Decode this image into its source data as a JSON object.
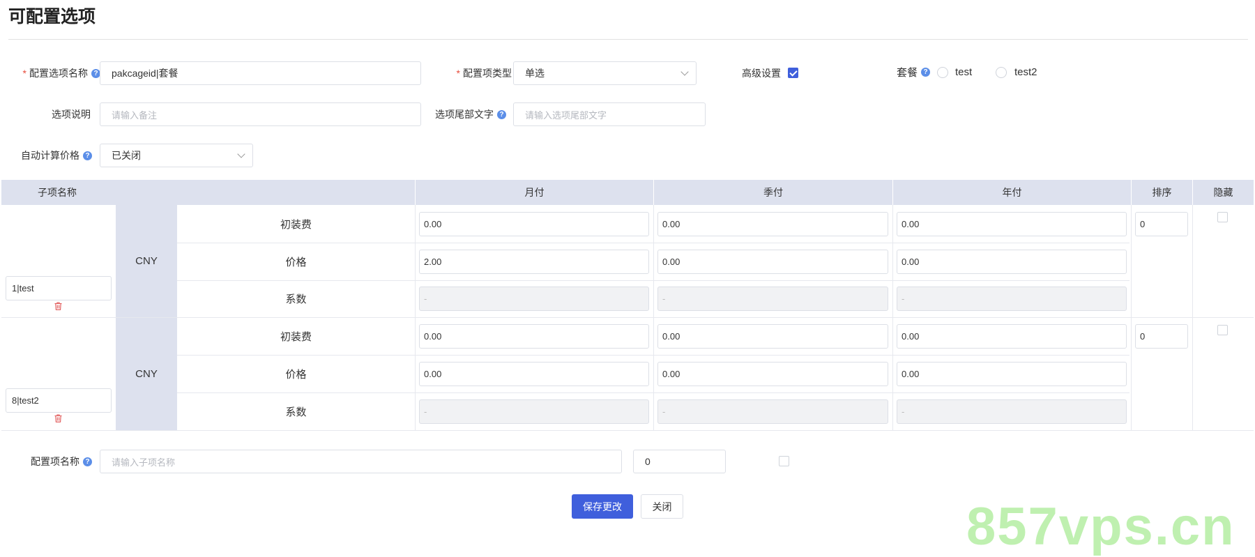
{
  "page": {
    "title": "可配置选项",
    "watermark": "857vps.cn"
  },
  "form": {
    "option_name": {
      "required_mark": "*",
      "label": "配置选项名称",
      "value": "pakcageid|套餐"
    },
    "option_type": {
      "required_mark": "*",
      "label": "配置项类型",
      "value": "单选"
    },
    "advanced": {
      "label": "高级设置",
      "checked": true
    },
    "package": {
      "label": "套餐",
      "options": [
        "test",
        "test2"
      ]
    },
    "description": {
      "label": "选项说明",
      "placeholder": "请输入备注"
    },
    "suffix": {
      "label": "选项尾部文字",
      "placeholder": "请输入选项尾部文字"
    },
    "auto_price": {
      "label": "自动计算价格",
      "value": "已关闭"
    },
    "help_glyph": "?"
  },
  "table": {
    "headers": {
      "name": "子项名称",
      "monthly": "月付",
      "quarterly": "季付",
      "yearly": "年付",
      "sort": "排序",
      "hidden": "隐藏"
    },
    "rows": [
      {
        "name": "1|test",
        "currency": "CNY",
        "sort": "0",
        "fees": [
          {
            "label": "初装费",
            "monthly": "0.00",
            "quarterly": "0.00",
            "yearly": "0.00"
          },
          {
            "label": "价格",
            "monthly": "2.00",
            "quarterly": "0.00",
            "yearly": "0.00"
          },
          {
            "label": "系数",
            "monthly": "-",
            "quarterly": "-",
            "yearly": "-"
          }
        ]
      },
      {
        "name": "8|test2",
        "currency": "CNY",
        "sort": "0",
        "fees": [
          {
            "label": "初装费",
            "monthly": "0.00",
            "quarterly": "0.00",
            "yearly": "0.00"
          },
          {
            "label": "价格",
            "monthly": "0.00",
            "quarterly": "0.00",
            "yearly": "0.00"
          },
          {
            "label": "系数",
            "monthly": "-",
            "quarterly": "-",
            "yearly": "-"
          }
        ]
      }
    ]
  },
  "new_item": {
    "label": "配置项名称",
    "placeholder": "请输入子项名称",
    "sort": "0"
  },
  "buttons": {
    "save": "保存更改",
    "close": "关闭"
  },
  "colors": {
    "primary": "#3f5fdc",
    "header_bg": "#dde1ee",
    "required": "#e74c3c",
    "help": "#5b8ee8"
  },
  "icons": {
    "help": "question-circle-icon",
    "delete": "trash-icon",
    "dropdown": "chevron-down-icon"
  }
}
